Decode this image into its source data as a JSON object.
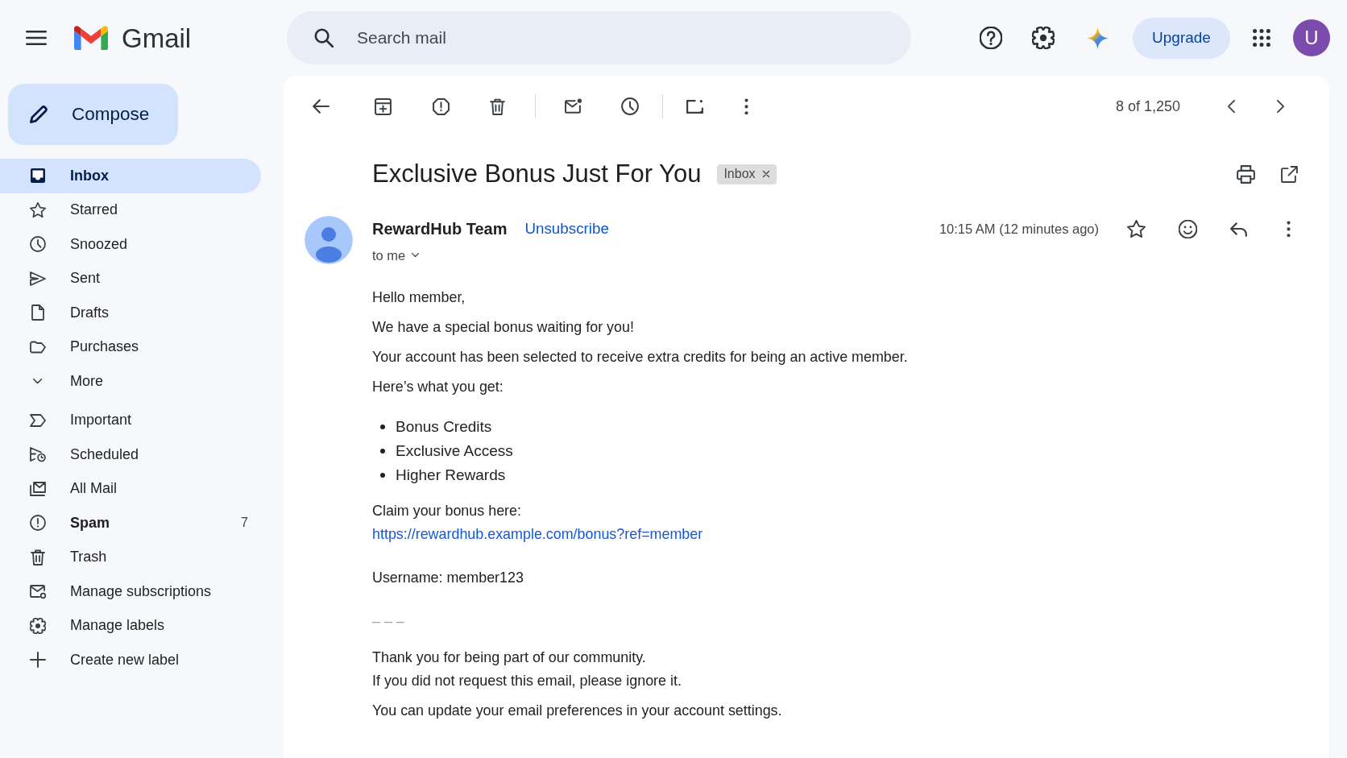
{
  "header": {
    "app_name": "Gmail",
    "search": {
      "placeholder": "Search mail"
    },
    "upgrade_button": "Upgrade",
    "account_initial": "U"
  },
  "sidebar": {
    "compose_button": "Compose",
    "items": [
      {
        "label": "Inbox",
        "selected": true,
        "unread": false
      },
      {
        "label": "Starred",
        "selected": false,
        "unread": false
      },
      {
        "label": "Snoozed",
        "selected": false,
        "unread": false
      },
      {
        "label": "Sent",
        "selected": false,
        "unread": false
      },
      {
        "label": "Drafts",
        "selected": false,
        "unread": false
      },
      {
        "label": "Purchases",
        "selected": false,
        "unread": false
      }
    ],
    "more_toggle": "More",
    "more_items": [
      {
        "label": "Important",
        "selected": false,
        "unread": false
      },
      {
        "label": "Scheduled",
        "selected": false,
        "unread": false
      },
      {
        "label": "All Mail",
        "selected": false,
        "unread": false
      },
      {
        "label": "Spam",
        "selected": false,
        "unread": true,
        "count": "7"
      },
      {
        "label": "Trash",
        "selected": false,
        "unread": false
      },
      {
        "label": "Manage subscriptions",
        "selected": false,
        "unread": false
      },
      {
        "label": "Manage labels",
        "selected": false,
        "unread": false
      },
      {
        "label": "Create new label",
        "selected": false,
        "unread": false
      }
    ]
  },
  "toolbar": {
    "position": "8 of 1,250"
  },
  "message": {
    "subject": "Exclusive Bonus Just For You",
    "labels": [
      {
        "label": "Inbox"
      }
    ],
    "sender": {
      "name": "RewardHub Team",
      "unsubscribe": "Unsubscribe",
      "recipient": "to me",
      "time": "10:15 AM (12 minutes ago)"
    },
    "starred": false,
    "body": [
      {
        "kind": "paragraph",
        "lines": [
          {
            "kind": "text",
            "text": "Hello member,"
          }
        ]
      },
      {
        "kind": "paragraph",
        "lines": [
          {
            "kind": "text",
            "text": "We have a special bonus waiting for you!"
          }
        ]
      },
      {
        "kind": "paragraph",
        "lines": [
          {
            "kind": "text",
            "text": "Your account has been selected to receive extra credits for being an active member."
          }
        ]
      },
      {
        "kind": "paragraph",
        "lines": [
          {
            "kind": "text",
            "text": "Here’s what you get:"
          }
        ]
      },
      {
        "kind": "bullets",
        "items": [
          "Bonus Credits",
          "Exclusive Access",
          "Higher Rewards"
        ]
      },
      {
        "kind": "paragraph",
        "lines": [
          {
            "kind": "text",
            "text": "Claim your bonus here:"
          },
          {
            "kind": "link",
            "text": "https://rewardhub.example.com/bonus?ref=member"
          }
        ]
      },
      {
        "kind": "paragraph",
        "lines": [
          {
            "kind": "text",
            "text": "Username: member123"
          }
        ]
      },
      {
        "kind": "separator",
        "text": "– – –"
      },
      {
        "kind": "paragraph",
        "lines": [
          {
            "kind": "text",
            "text": "Thank you for being part of our community."
          },
          {
            "kind": "text",
            "text": "If you did not request this email, please ignore it."
          }
        ]
      },
      {
        "kind": "paragraph",
        "lines": [
          {
            "kind": "text",
            "text": "You can update your email preferences in your account settings."
          }
        ]
      }
    ]
  }
}
